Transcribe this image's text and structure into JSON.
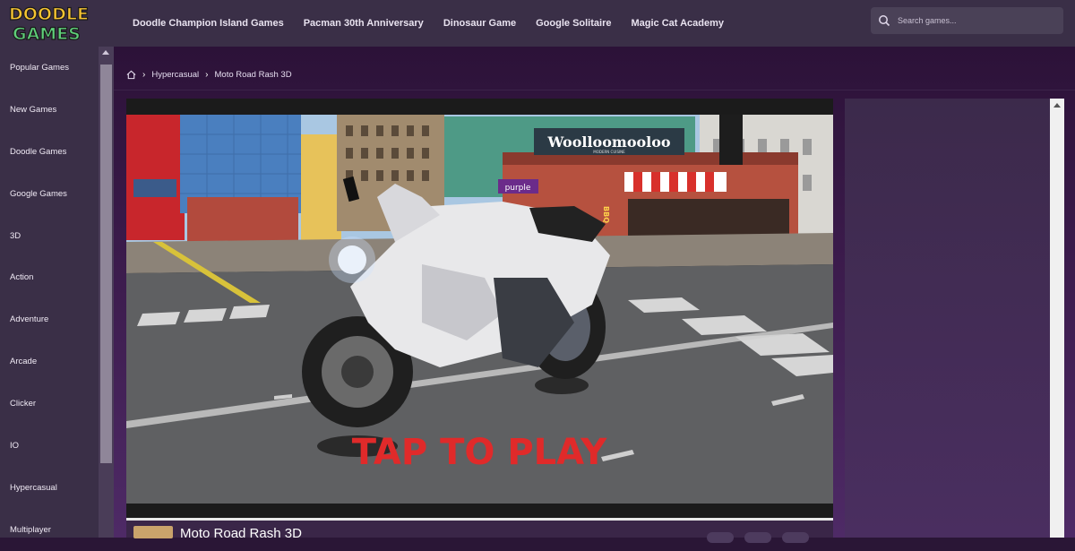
{
  "logo": {
    "line1": "DOODLE",
    "line2": "GAMES"
  },
  "header": {
    "nav": [
      "Doodle Champion Island Games",
      "Pacman 30th Anniversary",
      "Dinosaur Game",
      "Google Solitaire",
      "Magic Cat Academy"
    ],
    "search_placeholder": "Search games..."
  },
  "sidebar": {
    "items": [
      "Popular Games",
      "New Games",
      "Doodle Games",
      "Google Games",
      "3D",
      "Action",
      "Adventure",
      "Arcade",
      "Clicker",
      "IO",
      "Hypercasual",
      "Multiplayer"
    ]
  },
  "breadcrumb": {
    "category": "Hypercasual",
    "current": "Moto Road Rash 3D"
  },
  "game": {
    "title": "Moto Road Rash 3D",
    "cta": "TAP TO PLAY",
    "sign_text": "Woolloomooloo",
    "sign_sub": "MODERN CUISINE",
    "shop_sign": "purple",
    "bbq_sign": "BBQ"
  },
  "colors": {
    "header_bg": "#3a2f47",
    "page_bg": "#2a1636",
    "cta_red": "#e02a2a"
  }
}
